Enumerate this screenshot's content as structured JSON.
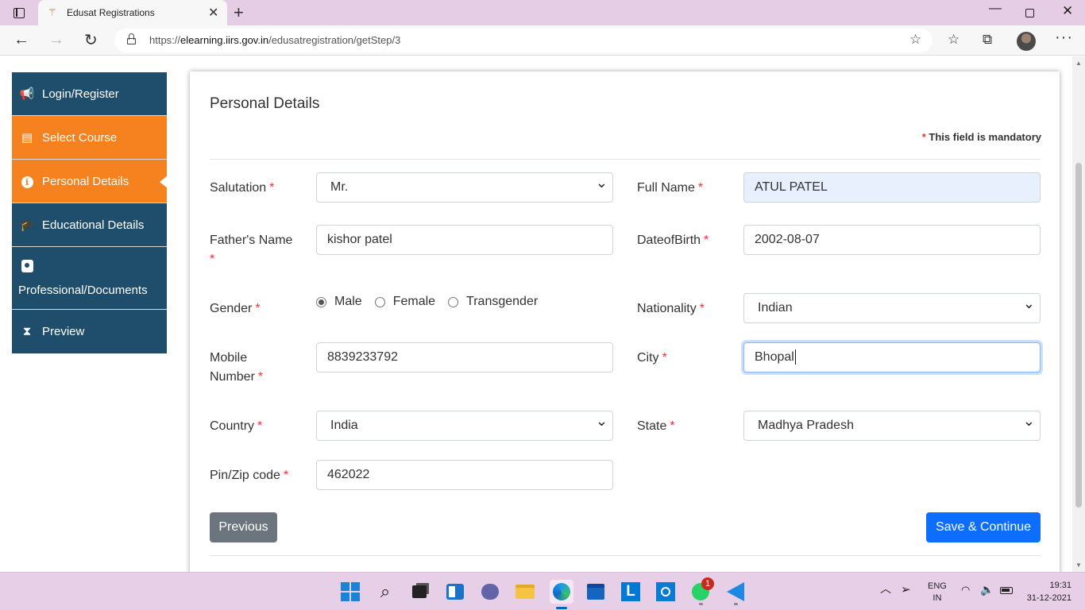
{
  "browser": {
    "tab_title": "Edusat Registrations",
    "url_prefix": "https://",
    "url_host": "elearning.iirs.gov.in",
    "url_path": "/edusatregistration/getStep/3"
  },
  "sidebar": {
    "items": [
      {
        "label": "Login/Register",
        "icon": "megaphone-icon"
      },
      {
        "label": "Select Course",
        "icon": "book-icon"
      },
      {
        "label": "Personal Details",
        "icon": "info-icon",
        "active": true
      },
      {
        "label": "Educational Details",
        "icon": "graduation-cap-icon"
      },
      {
        "label": "Professional/Documents",
        "icon": "id-badge-icon"
      },
      {
        "label": "Preview",
        "icon": "hourglass-icon"
      }
    ]
  },
  "form": {
    "title": "Personal Details",
    "mandatory_star": "*",
    "mandatory_note": "This field is mandatory",
    "salutation": {
      "label": "Salutation",
      "value": "Mr."
    },
    "full_name": {
      "label": "Full Name",
      "value": "ATUL PATEL"
    },
    "father_name": {
      "label": "Father's Name",
      "value": "kishor patel"
    },
    "dob": {
      "label": "DateofBirth",
      "value": "2002-08-07"
    },
    "gender": {
      "label": "Gender",
      "options": [
        "Male",
        "Female",
        "Transgender"
      ],
      "selected": "Male"
    },
    "nationality": {
      "label": "Nationality",
      "value": "Indian"
    },
    "mobile": {
      "label_line1": "Mobile",
      "label_line2": "Number",
      "value": "8839233792"
    },
    "city": {
      "label": "City",
      "value": "Bhopal"
    },
    "country": {
      "label": "Country",
      "value": "India"
    },
    "state": {
      "label": "State",
      "value": "Madhya Pradesh"
    },
    "pincode": {
      "label": "Pin/Zip code",
      "value": "462022"
    },
    "previous_label": "Previous",
    "save_label": "Save & Continue"
  },
  "taskbar": {
    "lang_line1": "ENG",
    "lang_line2": "IN",
    "time": "19:31",
    "date": "31-12-2021",
    "whatsapp_badge": "1"
  },
  "colors": {
    "sidebar_bg": "#1f4e6d",
    "sidebar_active": "#f5821f",
    "primary_button": "#0d6efd",
    "secondary_button": "#6c757d",
    "required_star": "#e53935"
  }
}
